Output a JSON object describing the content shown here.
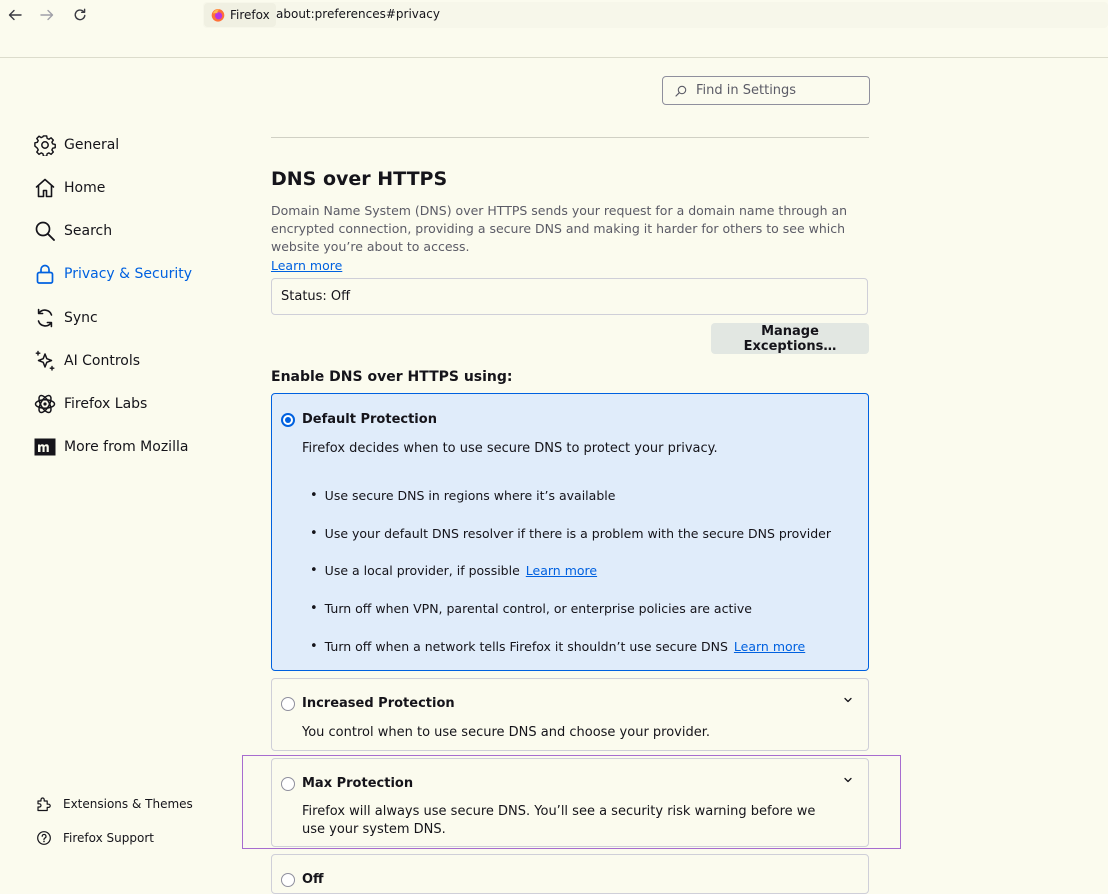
{
  "browser": {
    "identity_label": "Firefox",
    "url": "about:preferences#privacy"
  },
  "search": {
    "placeholder": "Find in Settings"
  },
  "sidebar": {
    "items": [
      {
        "label": "General",
        "icon": "gear-icon"
      },
      {
        "label": "Home",
        "icon": "home-icon"
      },
      {
        "label": "Search",
        "icon": "search-icon"
      },
      {
        "label": "Privacy & Security",
        "icon": "lock-icon",
        "active": true
      },
      {
        "label": "Sync",
        "icon": "sync-icon"
      },
      {
        "label": "AI Controls",
        "icon": "sparkle-icon"
      },
      {
        "label": "Firefox Labs",
        "icon": "labs-icon"
      },
      {
        "label": "More from Mozilla",
        "icon": "mozilla-icon"
      }
    ],
    "footer": [
      {
        "label": "Extensions & Themes",
        "icon": "puzzle-icon"
      },
      {
        "label": "Firefox Support",
        "icon": "help-icon"
      }
    ]
  },
  "dns": {
    "title": "DNS over HTTPS",
    "description": "Domain Name System (DNS) over HTTPS sends your request for a domain name through an encrypted connection, providing a secure DNS and making it harder for others to see which website you’re about to access.",
    "learn_more": "Learn more",
    "status": "Status: Off",
    "manage_exceptions": "Manage Exceptions…",
    "enable_heading": "Enable DNS over HTTPS using:",
    "options": {
      "default": {
        "title": "Default Protection",
        "description": "Firefox decides when to use secure DNS to protect your privacy.",
        "selected": true,
        "bullets": [
          {
            "text": "Use secure DNS in regions where it’s available",
            "link": ""
          },
          {
            "text": "Use your default DNS resolver if there is a problem with the secure DNS provider",
            "link": ""
          },
          {
            "text": "Use a local provider, if possible",
            "link": "Learn more"
          },
          {
            "text": "Turn off when VPN, parental control, or enterprise policies are active",
            "link": ""
          },
          {
            "text": "Turn off when a network tells Firefox it shouldn’t use secure DNS",
            "link": "Learn more"
          }
        ]
      },
      "increased": {
        "title": "Increased Protection",
        "description": "You control when to use secure DNS and choose your provider."
      },
      "max": {
        "title": "Max Protection",
        "description": "Firefox will always use secure DNS. You’ll see a security risk warning before we use your system DNS."
      },
      "off": {
        "title": "Off"
      }
    }
  },
  "colors": {
    "accent": "#0061e0",
    "background": "#fbfbee",
    "selected_card": "#e0ecfa",
    "focus_outline": "#a76ccf"
  }
}
